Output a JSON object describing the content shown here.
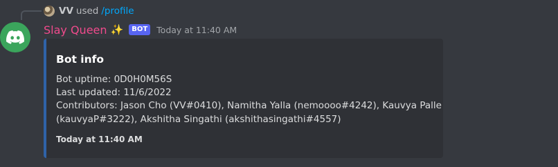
{
  "reply": {
    "user": "VV",
    "used_text": "used",
    "command": "/profile"
  },
  "message": {
    "username": "Slay Queen",
    "sparkle": "✨",
    "bot_tag": "BOT",
    "timestamp": "Today at 11:40 AM"
  },
  "embed": {
    "title": "Bot info",
    "uptime": "Bot uptime: 0D0H0M56S",
    "last_updated": "Last updated: 11/6/2022",
    "contributors_line1": "Contributors: Jason Cho (VV#0410), Namitha Yalla (nemoooo#4242), Kauvya Palle",
    "contributors_line2": "(kauvyaP#3222), Akshitha Singathi (akshithasingathi#4557)",
    "footer": "Today at 11:40 AM",
    "accent_color": "#2f63a8"
  },
  "colors": {
    "background": "#36393f",
    "embed_background": "#2f3136",
    "username": "#f04a8c",
    "bot_tag": "#5865f2",
    "command": "#00a8fc",
    "avatar": "#3ba55c"
  }
}
